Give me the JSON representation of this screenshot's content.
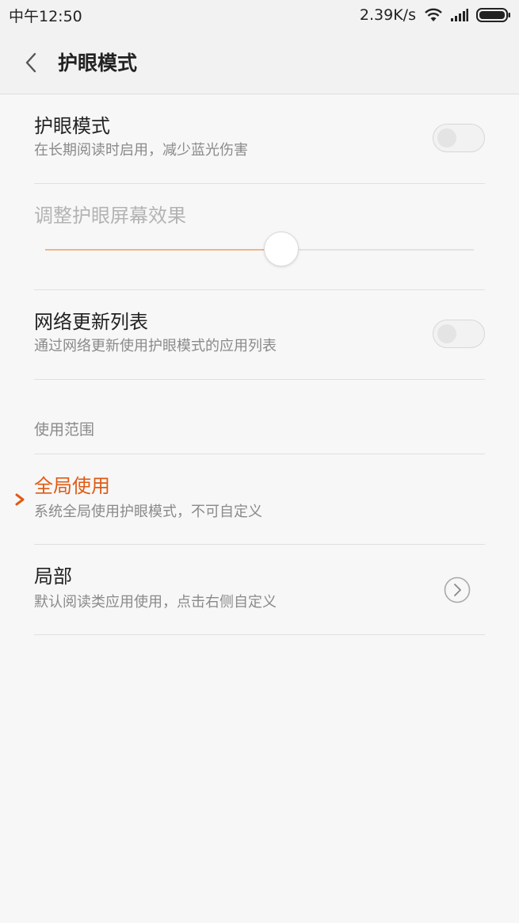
{
  "status_bar": {
    "time": "中午12:50",
    "network_speed": "2.39K/s",
    "icons": [
      "wifi-icon",
      "signal-icon",
      "battery-icon"
    ]
  },
  "header": {
    "back_icon": "chevron-left-icon",
    "title": "护眼模式"
  },
  "settings": {
    "eye_mode": {
      "title": "护眼模式",
      "subtitle": "在长期阅读时启用，减少蓝光伤害",
      "enabled": false
    },
    "screen_effect": {
      "title": "调整护眼屏幕效果",
      "level": 0.55
    },
    "network_update": {
      "title": "网络更新列表",
      "subtitle": "通过网络更新使用护眼模式的应用列表",
      "enabled": false
    }
  },
  "scope_section": {
    "label": "使用范围",
    "options": [
      {
        "title": "全局使用",
        "subtitle": "系统全局使用护眼模式，不可自定义",
        "selected": true
      },
      {
        "title": "局部",
        "subtitle": "默认阅读类应用使用，点击右侧自定义",
        "selected": false
      }
    ]
  },
  "colors": {
    "accent": "#e05a14",
    "slider_fill": "#f0b48c",
    "background": "#f7f7f7"
  }
}
